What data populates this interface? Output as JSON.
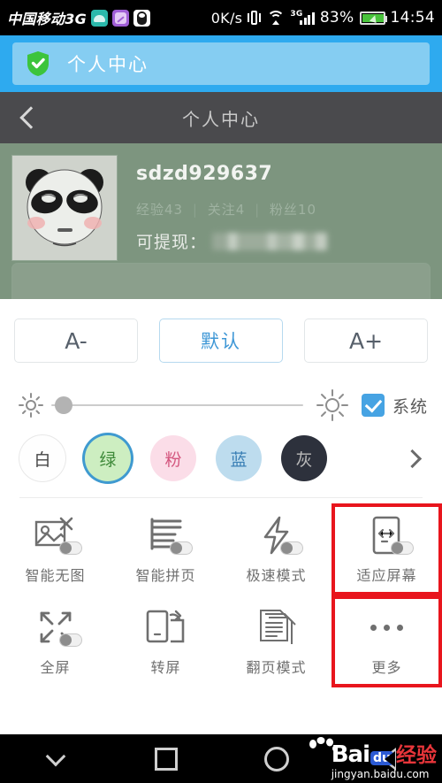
{
  "status_bar": {
    "carrier": "中国移动3G",
    "app_icons": [
      "teal-app-icon",
      "purple-photo-icon",
      "qq-penguin-icon"
    ],
    "net_speed": "0K/s",
    "vibrate_icon": "vibrate-icon",
    "wifi_icon": "wifi-icon",
    "signal_label": "3G",
    "battery_percent": "83%",
    "clock": "14:54"
  },
  "blue_banner": {
    "shield_icon": "shield-check-icon",
    "title": "个人中心"
  },
  "dark_nav": {
    "back_icon": "chevron-left-icon",
    "title": "个人中心"
  },
  "profile": {
    "avatar_icon": "panda-avatar",
    "username": "sdzd929637",
    "stats": [
      {
        "label": "经验",
        "value": "43"
      },
      {
        "label": "关注",
        "value": "4"
      },
      {
        "label": "粉丝",
        "value": "10"
      }
    ],
    "separator": "|",
    "cash_label": "可提现：",
    "cash_value_masked": true
  },
  "settings": {
    "font_buttons": [
      {
        "label": "A-",
        "selected": false
      },
      {
        "label": "默认",
        "selected": true
      },
      {
        "label": "A+",
        "selected": false
      }
    ],
    "brightness": {
      "low_icon": "sun-small-icon",
      "high_icon": "sun-large-icon",
      "value_percent": 4,
      "system_checked": true,
      "system_label": "系统",
      "accent": "#46a3e3"
    },
    "themes": [
      {
        "label": "白",
        "fill": "#fefefe",
        "text": "#444444",
        "border": "#e8e8e8",
        "selected": false
      },
      {
        "label": "绿",
        "fill": "#cdeec1",
        "text": "#3f8a3a",
        "border": "",
        "selected": true
      },
      {
        "label": "粉",
        "fill": "#fbdde8",
        "text": "#d4577f",
        "border": "",
        "selected": false
      },
      {
        "label": "蓝",
        "fill": "#bddcee",
        "text": "#3a7fb5",
        "border": "",
        "selected": false
      },
      {
        "label": "灰",
        "fill": "#2d313c",
        "text": "#b9b9b9",
        "border": "",
        "selected": false
      }
    ],
    "theme_more_icon": "chevron-right-icon",
    "grid": [
      {
        "label": "智能无图",
        "icon": "image-off-icon",
        "toggle": true,
        "toggle_on": false,
        "highlighted": false
      },
      {
        "label": "智能拼页",
        "icon": "merge-pages-icon",
        "toggle": true,
        "toggle_on": false,
        "highlighted": false
      },
      {
        "label": "极速模式",
        "icon": "lightning-icon",
        "toggle": true,
        "toggle_on": false,
        "highlighted": false
      },
      {
        "label": "适应屏幕",
        "icon": "fit-screen-icon",
        "toggle": true,
        "toggle_on": false,
        "highlighted": true
      },
      {
        "label": "全屏",
        "icon": "fullscreen-icon",
        "toggle": true,
        "toggle_on": false,
        "highlighted": false
      },
      {
        "label": "转屏",
        "icon": "rotate-screen-icon",
        "toggle": false,
        "toggle_on": false,
        "highlighted": false
      },
      {
        "label": "翻页模式",
        "icon": "page-flip-icon",
        "toggle": false,
        "toggle_on": false,
        "highlighted": false
      },
      {
        "label": "更多",
        "icon": "more-dots-icon",
        "toggle": false,
        "toggle_on": false,
        "highlighted": true
      }
    ],
    "highlight_color": "#e8151d"
  },
  "bottom_nav": {
    "buttons": [
      {
        "icon": "chevron-down-icon"
      },
      {
        "icon": "square-recents-icon"
      },
      {
        "icon": "circle-home-icon"
      },
      {
        "icon": "triangle-back-icon"
      }
    ],
    "watermark": {
      "bai": "Bai",
      "du": "du",
      "jingyan": "经验",
      "domain": "jingyan.baidu.com"
    }
  }
}
